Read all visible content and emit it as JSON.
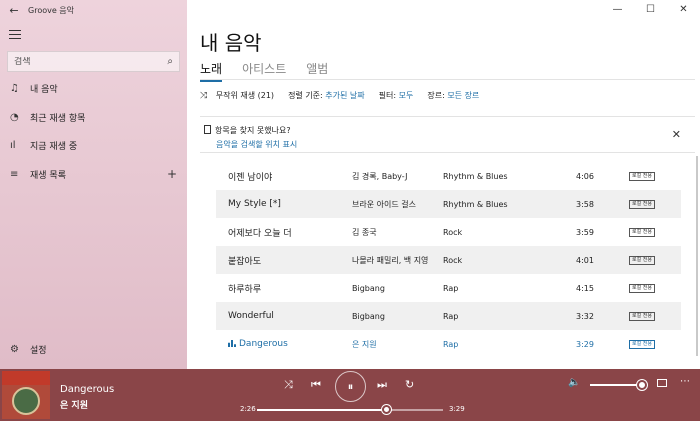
{
  "app": {
    "title": "Groove 음악",
    "back": "←",
    "window": {
      "minimize": "—",
      "maximize": "☐",
      "close": "✕"
    }
  },
  "sidebar": {
    "search_placeholder": "검색",
    "search_icon": "⌕",
    "items": [
      {
        "icon": "♫",
        "label": "내 음악",
        "icon_name": "music-note-icon"
      },
      {
        "icon": "◔",
        "label": "최근 재생 항목",
        "icon_name": "clock-icon"
      },
      {
        "icon": "ıl",
        "label": "지금 재생 중",
        "icon_name": "bars-icon"
      },
      {
        "icon": "≡",
        "label": "재생 목록",
        "icon_name": "playlist-icon",
        "action": "+"
      }
    ],
    "settings": {
      "icon": "⚙",
      "label": "설정"
    }
  },
  "main": {
    "title": "내 음악",
    "tabs": [
      {
        "label": "노래",
        "active": true
      },
      {
        "label": "아티스트",
        "active": false
      },
      {
        "label": "앨범",
        "active": false
      }
    ],
    "toolbar": {
      "shuffle_icon": "⤨",
      "shuffle_label": "무작위 재생 (21)",
      "sort_label": "정렬 기준:",
      "sort_value": "추가된 날짜",
      "filter_label": "필터:",
      "filter_value": "모두",
      "genre_label": "장르:",
      "genre_value": "모든 장르"
    },
    "notice": {
      "text": "항목을 찾지 못했나요?",
      "link": "음악을 검색할 위치 표시",
      "close": "✕"
    },
    "songs": [
      {
        "title": "이젠 남이야",
        "artist": "김 경록, Baby-J",
        "genre": "Rhythm & Blues",
        "duration": "4:06",
        "badge": "로컬 전용"
      },
      {
        "title": "My Style [*]",
        "artist": "브라운 아이드 걸스",
        "genre": "Rhythm & Blues",
        "duration": "3:58",
        "badge": "로컬 전용"
      },
      {
        "title": "어제보다 오늘 더",
        "artist": "김 종국",
        "genre": "Rock",
        "duration": "3:59",
        "badge": "로컬 전용"
      },
      {
        "title": "붙잡아도",
        "artist": "나몰라 패밀리, 백 지영",
        "genre": "Rock",
        "duration": "4:01",
        "badge": "로컬 전용"
      },
      {
        "title": "하루하루",
        "artist": "Bigbang",
        "genre": "Rap",
        "duration": "4:15",
        "badge": "로컬 전용"
      },
      {
        "title": "Wonderful",
        "artist": "Bigbang",
        "genre": "Rap",
        "duration": "3:32",
        "badge": "로컬 전용"
      },
      {
        "title": "Dangerous",
        "artist": "은 지원",
        "genre": "Rap",
        "duration": "3:29",
        "badge": "로컬 전용"
      }
    ]
  },
  "player": {
    "title": "Dangerous",
    "artist": "은 지원",
    "elapsed": "2:26",
    "total": "3:29",
    "progress": 0.7,
    "volume": 0.95,
    "icons": {
      "shuffle": "⤨",
      "prev": "⏮",
      "play": "⏸",
      "next": "⏭",
      "repeat": "↻",
      "volume": "🔈",
      "more": "⋯"
    }
  },
  "colors": {
    "accent": "#1e6ea6",
    "player_bg": "#8a4548",
    "sidebar_bg": "#e7c8d2"
  }
}
